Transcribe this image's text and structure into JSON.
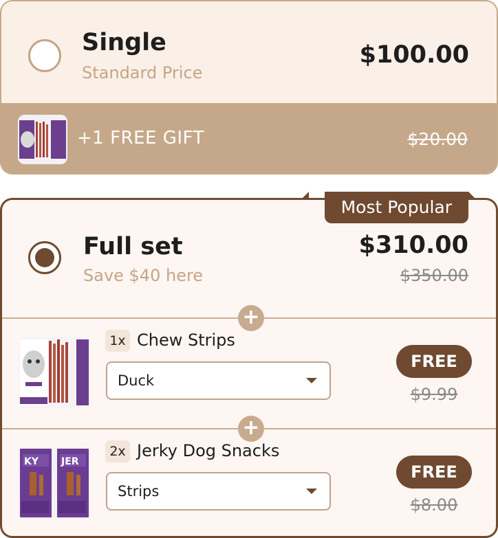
{
  "single": {
    "title": "Single",
    "subtitle": "Standard Price",
    "price": "$100.00",
    "gift_text": "+1  FREE GIFT",
    "gift_old_price": "$20.00"
  },
  "full_set": {
    "badge": "Most Popular",
    "title": "Full set",
    "subtitle": "Save $40 here",
    "price": "$310.00",
    "old_price": "$350.00",
    "items": [
      {
        "qty": "1x",
        "name": "Chew Strips",
        "selected": "Duck",
        "price_label": "FREE",
        "old_price": "$9.99"
      },
      {
        "qty": "2x",
        "name": "Jerky Dog Snacks",
        "selected": "Strips",
        "price_label": "FREE",
        "old_price": "$8.00"
      }
    ]
  },
  "colors": {
    "accent_brown": "#6f4a30",
    "tan": "#c5a88a",
    "cream": "#fbf0e7"
  }
}
